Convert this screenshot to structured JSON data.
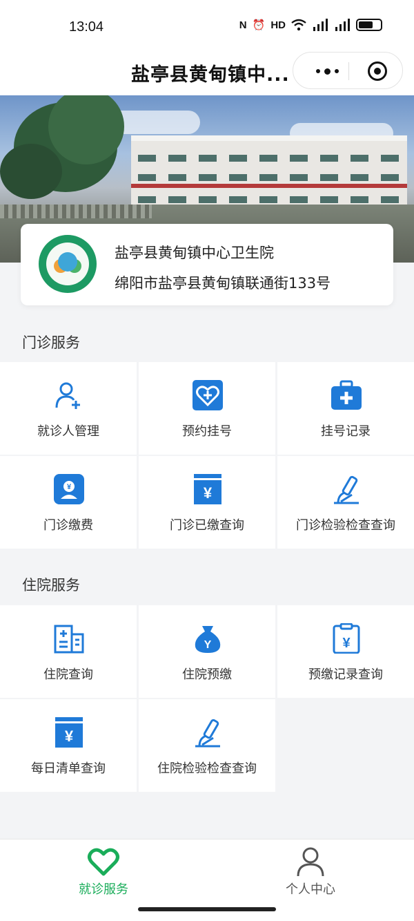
{
  "status_bar": {
    "time": "13:04",
    "icons": [
      "nfc-icon",
      "alarm-icon",
      "hd-icon",
      "wifi-icon",
      "signal-icon",
      "signal-icon",
      "battery-icon"
    ]
  },
  "nav": {
    "title": "盐亭县黄甸镇中..."
  },
  "hospital": {
    "name": "盐亭县黄甸镇中心卫生院",
    "address": "绵阳市盐亭县黄甸镇联通街133号"
  },
  "outpatient": {
    "title": "门诊服务",
    "items": [
      {
        "label": "就诊人管理",
        "icon": "add-user-icon"
      },
      {
        "label": "预约挂号",
        "icon": "heart-plus-icon"
      },
      {
        "label": "挂号记录",
        "icon": "medical-kit-icon"
      },
      {
        "label": "门诊缴费",
        "icon": "payment-icon"
      },
      {
        "label": "门诊已缴查询",
        "icon": "yuan-receipt-icon"
      },
      {
        "label": "门诊检验检查查询",
        "icon": "microscope-icon"
      }
    ]
  },
  "inpatient": {
    "title": "住院服务",
    "items": [
      {
        "label": "住院查询",
        "icon": "hospital-building-icon"
      },
      {
        "label": "住院预缴",
        "icon": "money-bag-icon"
      },
      {
        "label": "预缴记录查询",
        "icon": "clipboard-yuan-icon"
      },
      {
        "label": "每日清单查询",
        "icon": "yuan-receipt-icon"
      },
      {
        "label": "住院检验检查查询",
        "icon": "microscope-icon"
      }
    ]
  },
  "tabs": [
    {
      "label": "就诊服务",
      "icon": "heart-icon",
      "active": true
    },
    {
      "label": "个人中心",
      "icon": "person-icon",
      "active": false
    }
  ],
  "colors": {
    "accent_blue": "#1f7ad8",
    "tab_active_green": "#1aad5a",
    "tab_inactive": "#555555"
  }
}
